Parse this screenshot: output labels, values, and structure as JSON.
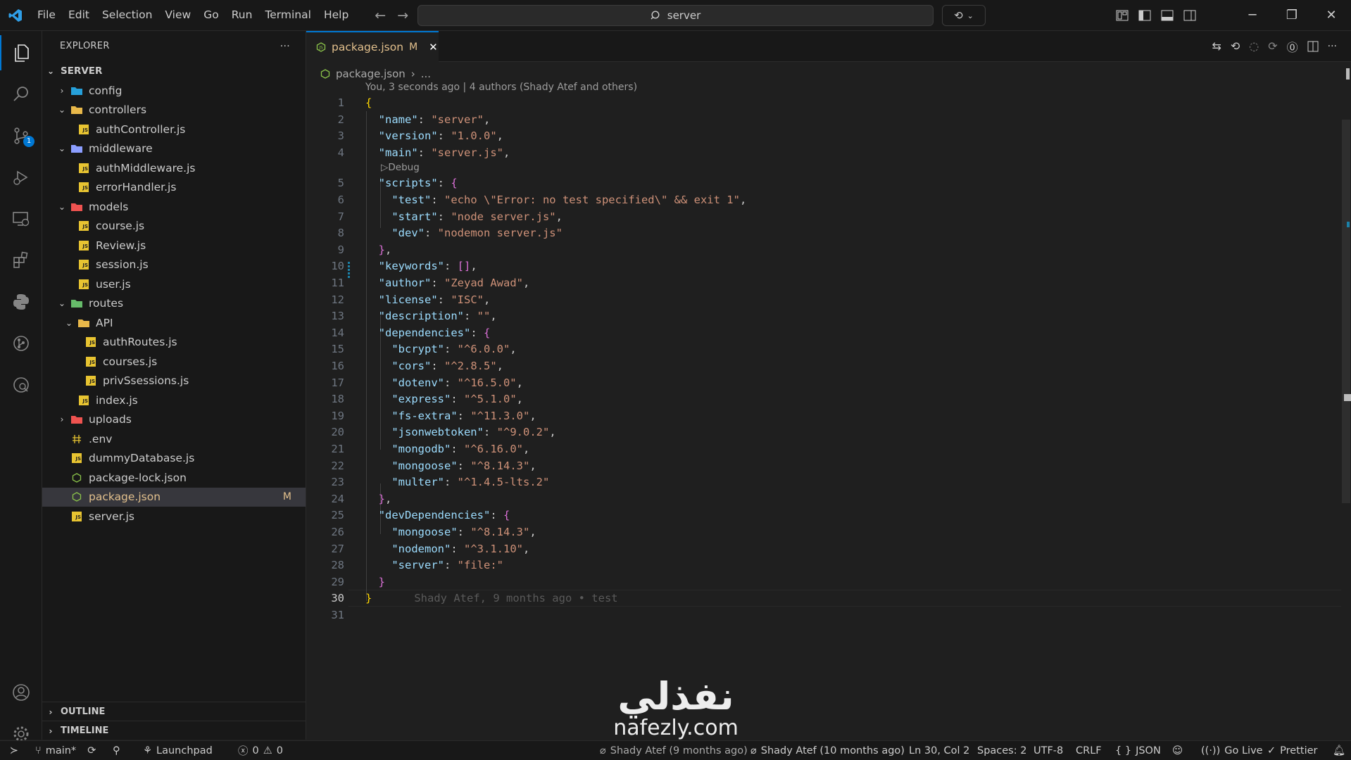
{
  "titlebar": {
    "menu": [
      "File",
      "Edit",
      "Selection",
      "View",
      "Go",
      "Run",
      "Terminal",
      "Help"
    ],
    "search_text": "server"
  },
  "activity": {
    "scm_badge": "1"
  },
  "sidebar": {
    "title": "EXPLORER",
    "more": "···",
    "root": "SERVER",
    "tree": [
      {
        "label": "config",
        "type": "folder",
        "depth": 0,
        "open": false,
        "color": "#26a0da"
      },
      {
        "label": "controllers",
        "type": "folder",
        "depth": 0,
        "open": true,
        "color": "#e8b84a"
      },
      {
        "label": "authController.js",
        "type": "js",
        "depth": 1
      },
      {
        "label": "middleware",
        "type": "folder",
        "depth": 0,
        "open": true,
        "color": "#8c9eff"
      },
      {
        "label": "authMiddleware.js",
        "type": "js",
        "depth": 1
      },
      {
        "label": "errorHandler.js",
        "type": "js",
        "depth": 1
      },
      {
        "label": "models",
        "type": "folder",
        "depth": 0,
        "open": true,
        "color": "#ef5350"
      },
      {
        "label": "course.js",
        "type": "js",
        "depth": 1
      },
      {
        "label": "Review.js",
        "type": "js",
        "depth": 1
      },
      {
        "label": "session.js",
        "type": "js",
        "depth": 1
      },
      {
        "label": "user.js",
        "type": "js",
        "depth": 1
      },
      {
        "label": "routes",
        "type": "folder",
        "depth": 0,
        "open": true,
        "color": "#66bb6a"
      },
      {
        "label": "API",
        "type": "folder",
        "depth": 1,
        "open": true,
        "color": "#e8b84a"
      },
      {
        "label": "authRoutes.js",
        "type": "js",
        "depth": 2
      },
      {
        "label": "courses.js",
        "type": "js",
        "depth": 2
      },
      {
        "label": "privSsessions.js",
        "type": "js",
        "depth": 2
      },
      {
        "label": "index.js",
        "type": "js",
        "depth": 1
      },
      {
        "label": "uploads",
        "type": "folder",
        "depth": 0,
        "open": false,
        "color": "#ef5350"
      },
      {
        "label": ".env",
        "type": "env",
        "depth": 0
      },
      {
        "label": "dummyDatabase.js",
        "type": "js",
        "depth": 0
      },
      {
        "label": "package-lock.json",
        "type": "npm",
        "depth": 0
      },
      {
        "label": "package.json",
        "type": "npm",
        "depth": 0,
        "selected": true,
        "flag": "M"
      },
      {
        "label": "server.js",
        "type": "js",
        "depth": 0
      }
    ],
    "outline": "OUTLINE",
    "timeline": "TIMELINE"
  },
  "editor": {
    "tab_label": "package.json",
    "tab_flag": "M",
    "breadcrumb_file": "package.json",
    "breadcrumb_rest": "...",
    "blame_header": "You, 3 seconds ago | 4 authors (Shady Atef and others)",
    "codelens": "Debug",
    "inline_blame": "Shady Atef, 9 months ago • test",
    "lines": [
      {
        "n": "1",
        "t": [
          [
            "{",
            "b1"
          ]
        ]
      },
      {
        "n": "2",
        "t": [
          [
            "  ",
            ""
          ],
          [
            "\"name\"",
            "k"
          ],
          [
            ": ",
            "p"
          ],
          [
            "\"server\"",
            "s"
          ],
          [
            ",",
            "p"
          ]
        ]
      },
      {
        "n": "3",
        "t": [
          [
            "  ",
            ""
          ],
          [
            "\"version\"",
            "k"
          ],
          [
            ": ",
            "p"
          ],
          [
            "\"1.0.0\"",
            "s"
          ],
          [
            ",",
            "p"
          ]
        ]
      },
      {
        "n": "4",
        "t": [
          [
            "  ",
            ""
          ],
          [
            "\"main\"",
            "k"
          ],
          [
            ": ",
            "p"
          ],
          [
            "\"server.js\"",
            "s"
          ],
          [
            ",",
            "p"
          ]
        ]
      },
      {
        "n": "5",
        "t": [
          [
            "  ",
            ""
          ],
          [
            "\"scripts\"",
            "k"
          ],
          [
            ": ",
            "p"
          ],
          [
            "{",
            "b2"
          ]
        ]
      },
      {
        "n": "6",
        "t": [
          [
            "    ",
            ""
          ],
          [
            "\"test\"",
            "k"
          ],
          [
            ": ",
            "p"
          ],
          [
            "\"echo \\\"Error: no test specified\\\" && exit 1\"",
            "s"
          ],
          [
            ",",
            "p"
          ]
        ]
      },
      {
        "n": "7",
        "t": [
          [
            "    ",
            ""
          ],
          [
            "\"start\"",
            "k"
          ],
          [
            ": ",
            "p"
          ],
          [
            "\"node server.js\"",
            "s"
          ],
          [
            ",",
            "p"
          ]
        ]
      },
      {
        "n": "8",
        "t": [
          [
            "    ",
            ""
          ],
          [
            "\"dev\"",
            "k"
          ],
          [
            ": ",
            "p"
          ],
          [
            "\"nodemon server.js\"",
            "s"
          ]
        ]
      },
      {
        "n": "9",
        "t": [
          [
            "  ",
            ""
          ],
          [
            "}",
            "b2"
          ],
          [
            ",",
            "p"
          ]
        ]
      },
      {
        "n": "10",
        "t": [
          [
            "  ",
            ""
          ],
          [
            "\"keywords\"",
            "k"
          ],
          [
            ": ",
            "p"
          ],
          [
            "[]",
            "b2"
          ],
          [
            ",",
            "p"
          ]
        ]
      },
      {
        "n": "11",
        "t": [
          [
            "  ",
            ""
          ],
          [
            "\"author\"",
            "k"
          ],
          [
            ": ",
            "p"
          ],
          [
            "\"Zeyad Awad\"",
            "s"
          ],
          [
            ",",
            "p"
          ]
        ]
      },
      {
        "n": "12",
        "t": [
          [
            "  ",
            ""
          ],
          [
            "\"license\"",
            "k"
          ],
          [
            ": ",
            "p"
          ],
          [
            "\"ISC\"",
            "s"
          ],
          [
            ",",
            "p"
          ]
        ]
      },
      {
        "n": "13",
        "t": [
          [
            "  ",
            ""
          ],
          [
            "\"description\"",
            "k"
          ],
          [
            ": ",
            "p"
          ],
          [
            "\"\"",
            "s"
          ],
          [
            ",",
            "p"
          ]
        ]
      },
      {
        "n": "14",
        "t": [
          [
            "  ",
            ""
          ],
          [
            "\"dependencies\"",
            "k"
          ],
          [
            ": ",
            "p"
          ],
          [
            "{",
            "b2"
          ]
        ]
      },
      {
        "n": "15",
        "t": [
          [
            "    ",
            ""
          ],
          [
            "\"bcrypt\"",
            "k"
          ],
          [
            ": ",
            "p"
          ],
          [
            "\"^6.0.0\"",
            "s"
          ],
          [
            ",",
            "p"
          ]
        ]
      },
      {
        "n": "16",
        "t": [
          [
            "    ",
            ""
          ],
          [
            "\"cors\"",
            "k"
          ],
          [
            ": ",
            "p"
          ],
          [
            "\"^2.8.5\"",
            "s"
          ],
          [
            ",",
            "p"
          ]
        ]
      },
      {
        "n": "17",
        "t": [
          [
            "    ",
            ""
          ],
          [
            "\"dotenv\"",
            "k"
          ],
          [
            ": ",
            "p"
          ],
          [
            "\"^16.5.0\"",
            "s"
          ],
          [
            ",",
            "p"
          ]
        ]
      },
      {
        "n": "18",
        "t": [
          [
            "    ",
            ""
          ],
          [
            "\"express\"",
            "k"
          ],
          [
            ": ",
            "p"
          ],
          [
            "\"^5.1.0\"",
            "s"
          ],
          [
            ",",
            "p"
          ]
        ]
      },
      {
        "n": "19",
        "t": [
          [
            "    ",
            ""
          ],
          [
            "\"fs-extra\"",
            "k"
          ],
          [
            ": ",
            "p"
          ],
          [
            "\"^11.3.0\"",
            "s"
          ],
          [
            ",",
            "p"
          ]
        ]
      },
      {
        "n": "20",
        "t": [
          [
            "    ",
            ""
          ],
          [
            "\"jsonwebtoken\"",
            "k"
          ],
          [
            ": ",
            "p"
          ],
          [
            "\"^9.0.2\"",
            "s"
          ],
          [
            ",",
            "p"
          ]
        ]
      },
      {
        "n": "21",
        "t": [
          [
            "    ",
            ""
          ],
          [
            "\"mongodb\"",
            "k"
          ],
          [
            ": ",
            "p"
          ],
          [
            "\"^6.16.0\"",
            "s"
          ],
          [
            ",",
            "p"
          ]
        ]
      },
      {
        "n": "22",
        "t": [
          [
            "    ",
            ""
          ],
          [
            "\"mongoose\"",
            "k"
          ],
          [
            ": ",
            "p"
          ],
          [
            "\"^8.14.3\"",
            "s"
          ],
          [
            ",",
            "p"
          ]
        ]
      },
      {
        "n": "23",
        "t": [
          [
            "    ",
            ""
          ],
          [
            "\"multer\"",
            "k"
          ],
          [
            ": ",
            "p"
          ],
          [
            "\"^1.4.5-lts.2\"",
            "s"
          ]
        ]
      },
      {
        "n": "24",
        "t": [
          [
            "  ",
            ""
          ],
          [
            "}",
            "b2"
          ],
          [
            ",",
            "p"
          ]
        ]
      },
      {
        "n": "25",
        "t": [
          [
            "  ",
            ""
          ],
          [
            "\"devDependencies\"",
            "k"
          ],
          [
            ": ",
            "p"
          ],
          [
            "{",
            "b2"
          ]
        ]
      },
      {
        "n": "26",
        "t": [
          [
            "    ",
            ""
          ],
          [
            "\"mongoose\"",
            "k"
          ],
          [
            ": ",
            "p"
          ],
          [
            "\"^8.14.3\"",
            "s"
          ],
          [
            ",",
            "p"
          ]
        ]
      },
      {
        "n": "27",
        "t": [
          [
            "    ",
            ""
          ],
          [
            "\"nodemon\"",
            "k"
          ],
          [
            ": ",
            "p"
          ],
          [
            "\"^3.1.10\"",
            "s"
          ],
          [
            ",",
            "p"
          ]
        ]
      },
      {
        "n": "28",
        "t": [
          [
            "    ",
            ""
          ],
          [
            "\"server\"",
            "k"
          ],
          [
            ": ",
            "p"
          ],
          [
            "\"file:\"",
            "s"
          ]
        ]
      },
      {
        "n": "29",
        "t": [
          [
            "  ",
            ""
          ],
          [
            "}",
            "b2"
          ]
        ]
      },
      {
        "n": "30",
        "t": [
          [
            "}",
            "b1"
          ]
        ]
      },
      {
        "n": "31",
        "t": []
      }
    ]
  },
  "watermark": {
    "arabic": "نفذلي",
    "latin": "nafezly.com"
  },
  "statusbar": {
    "branch": "main*",
    "launchpad": "Launchpad",
    "errors": "0",
    "warnings": "0",
    "blame_a": "Shady Atef (9 months ago)",
    "blame_b": "Shady Atef (10 months ago)",
    "position": "Ln 30, Col 2",
    "spaces": "Spaces: 2",
    "encoding": "UTF-8",
    "eol": "CRLF",
    "language": "JSON",
    "golive": "Go Live",
    "prettier": "Prettier"
  }
}
